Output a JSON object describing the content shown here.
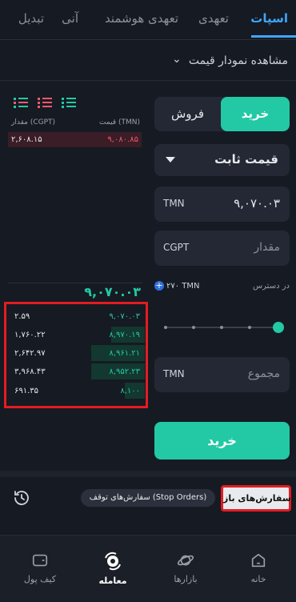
{
  "tabs": [
    {
      "label": "اسپات",
      "active": true
    },
    {
      "label": "تعهدی",
      "active": false
    },
    {
      "label": "تعهدی هوشمند",
      "active": false
    },
    {
      "label": "آنی",
      "active": false
    },
    {
      "label": "تبدیل",
      "active": false
    }
  ],
  "chart_toggle": {
    "label": "مشاهده نمودار قیمت",
    "icon": "chevron-down-icon"
  },
  "trade_form": {
    "buy_label": "خرید",
    "sell_label": "فروش",
    "order_type": "قیمت ثابت",
    "price": {
      "unit": "TMN",
      "value": "۹,۰۷۰.۰۳"
    },
    "amount": {
      "unit": "CGPT",
      "placeholder": "مقدار"
    },
    "available": {
      "label": "در دسترس",
      "value": "۲۷۰ TMN"
    },
    "slider_percent": 100,
    "total": {
      "unit": "TMN",
      "placeholder": "مجموع"
    },
    "submit_label": "خرید"
  },
  "order_book": {
    "price_header": "قیمت (TMN)",
    "amount_header": "مقدار (CGPT)",
    "asks": [
      {
        "price": "۹,۰۸۰.۸۵",
        "amount": "۲,۶۰۸.۱۵"
      }
    ],
    "last_price": "۹,۰۷۰.۰۳",
    "bids": [
      {
        "price": "۹,۰۷۰.۰۳",
        "amount": "۲.۵۹",
        "depth_percent": 0
      },
      {
        "price": "۸,۹۷۰.۱۹",
        "amount": "۱,۷۶۰.۲۲",
        "depth_percent": 62
      },
      {
        "price": "۸,۹۶۱.۲۱",
        "amount": "۲,۶۴۲.۹۷",
        "depth_percent": 100
      },
      {
        "price": "۸,۹۵۲.۲۳",
        "amount": "۳,۹۶۸.۴۳",
        "depth_percent": 100
      },
      {
        "price": "۸,۱۰۰",
        "amount": "۶۹۱.۳۵",
        "depth_percent": 37
      }
    ]
  },
  "orders_bar": {
    "open_orders_label": "سفارش‌های باز",
    "stop_orders_label": "سفارش‌های توقف (Stop Orders)",
    "history_icon": "history-icon"
  },
  "bottom_nav": [
    {
      "label": "خانه",
      "icon": "home-icon",
      "active": false
    },
    {
      "label": "بازارها",
      "icon": "planet-icon",
      "active": false
    },
    {
      "label": "معامله",
      "icon": "trade-icon",
      "active": true
    },
    {
      "label": "کیف پول",
      "icon": "wallet-icon",
      "active": false
    }
  ],
  "colors": {
    "accent_green": "#22c9a4",
    "ask_red": "#f0596c",
    "tab_blue": "#3fa6ff",
    "highlight_red": "#e31c23",
    "background": "#161a22"
  }
}
